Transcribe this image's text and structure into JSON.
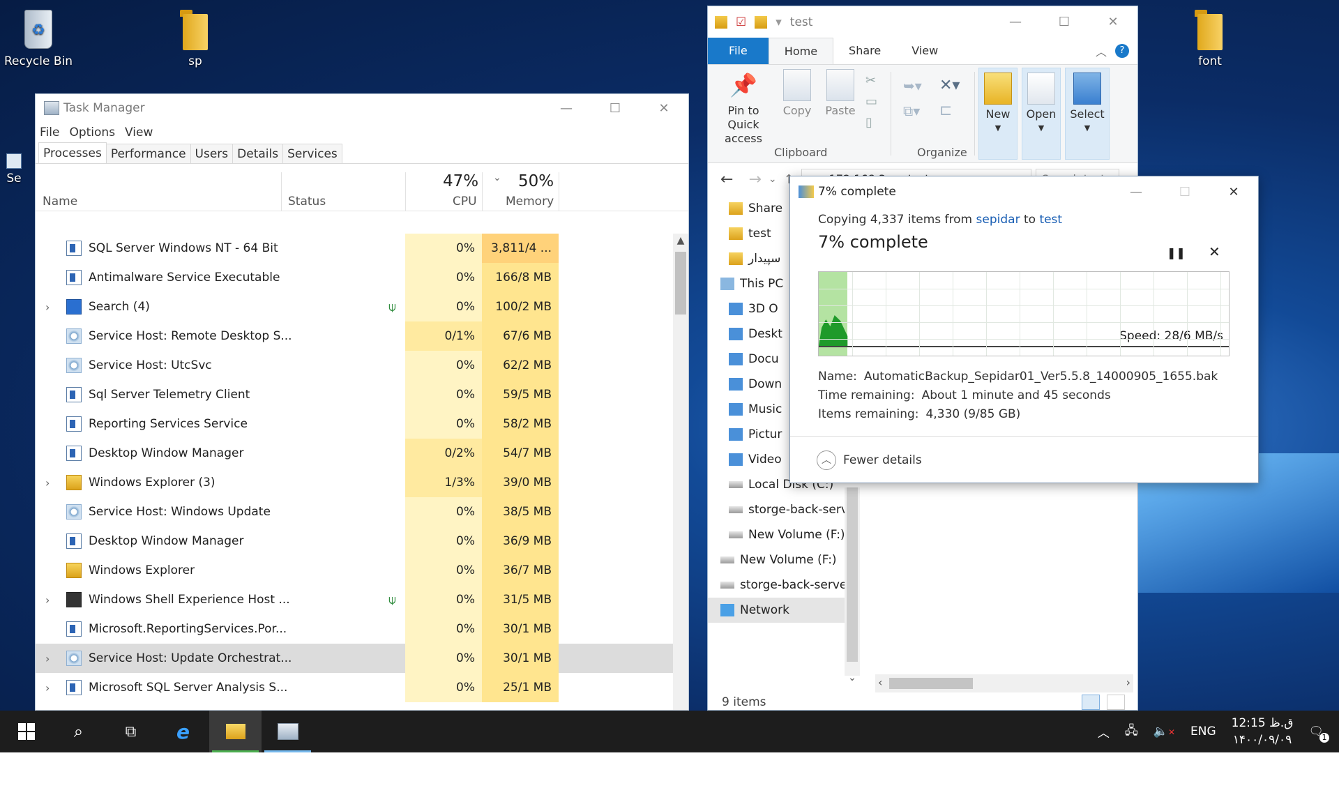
{
  "desktop": {
    "icons": [
      {
        "label": "Recycle Bin"
      },
      {
        "label": "sp"
      },
      {
        "label": "font"
      },
      {
        "label": "Se"
      }
    ]
  },
  "task_manager": {
    "title": "Task Manager",
    "menu": [
      "File",
      "Options",
      "View"
    ],
    "tabs": [
      "Processes",
      "Performance",
      "Users",
      "Details",
      "Services"
    ],
    "columns": {
      "name": "Name",
      "status": "Status",
      "cpu_pct": "47%",
      "cpu": "CPU",
      "mem_pct": "50%",
      "memory": "Memory"
    },
    "processes": [
      {
        "name": "SQL Server Windows NT - 64 Bit",
        "cpu": "0%",
        "mem": "3,811/4 ...",
        "icon": "app",
        "expand": false,
        "leaf": false
      },
      {
        "name": "Antimalware Service Executable",
        "cpu": "0%",
        "mem": "166/8 MB",
        "icon": "app",
        "expand": false,
        "leaf": false
      },
      {
        "name": "Search (4)",
        "cpu": "0%",
        "mem": "100/2 MB",
        "icon": "search",
        "expand": true,
        "leaf": true
      },
      {
        "name": "Service Host: Remote Desktop S...",
        "cpu": "0/1%",
        "mem": "67/6 MB",
        "icon": "svc",
        "expand": false,
        "leaf": false
      },
      {
        "name": "Service Host: UtcSvc",
        "cpu": "0%",
        "mem": "62/2 MB",
        "icon": "svc",
        "expand": false,
        "leaf": false
      },
      {
        "name": "Sql Server Telemetry Client",
        "cpu": "0%",
        "mem": "59/5 MB",
        "icon": "app",
        "expand": false,
        "leaf": false
      },
      {
        "name": "Reporting Services Service",
        "cpu": "0%",
        "mem": "58/2 MB",
        "icon": "app",
        "expand": false,
        "leaf": false
      },
      {
        "name": "Desktop Window Manager",
        "cpu": "0/2%",
        "mem": "54/7 MB",
        "icon": "app",
        "expand": false,
        "leaf": false
      },
      {
        "name": "Windows Explorer (3)",
        "cpu": "1/3%",
        "mem": "39/0 MB",
        "icon": "explorer",
        "expand": true,
        "leaf": false
      },
      {
        "name": "Service Host: Windows Update",
        "cpu": "0%",
        "mem": "38/5 MB",
        "icon": "svc",
        "expand": false,
        "leaf": false
      },
      {
        "name": "Desktop Window Manager",
        "cpu": "0%",
        "mem": "36/9 MB",
        "icon": "app",
        "expand": false,
        "leaf": false
      },
      {
        "name": "Windows Explorer",
        "cpu": "0%",
        "mem": "36/7 MB",
        "icon": "explorer",
        "expand": false,
        "leaf": false
      },
      {
        "name": "Windows Shell Experience Host ...",
        "cpu": "0%",
        "mem": "31/5 MB",
        "icon": "shell",
        "expand": true,
        "leaf": true
      },
      {
        "name": "Microsoft.ReportingServices.Por...",
        "cpu": "0%",
        "mem": "30/1 MB",
        "icon": "app",
        "expand": false,
        "leaf": false
      },
      {
        "name": "Service Host: Update Orchestrat...",
        "cpu": "0%",
        "mem": "30/1 MB",
        "icon": "svc",
        "expand": true,
        "leaf": false,
        "selected": true
      },
      {
        "name": "Microsoft SQL Server Analysis S...",
        "cpu": "0%",
        "mem": "25/1 MB",
        "icon": "app",
        "expand": true,
        "leaf": false
      }
    ],
    "colors": {
      "cpu_light": "#fff4c4",
      "cpu_mid": "#ffeaa0",
      "mem_hot": "#ffd27a",
      "mem_mid": "#ffe58f"
    }
  },
  "explorer": {
    "title": "test",
    "ribbon_tabs": [
      "File",
      "Home",
      "Share",
      "View"
    ],
    "buttons": {
      "pin": "Pin to Quick access",
      "copy": "Copy",
      "paste": "Paste",
      "new": "New",
      "open": "Open",
      "select": "Select"
    },
    "groups": {
      "clipboard": "Clipboard",
      "organize": "Organize"
    },
    "address": "« 172.168.3... › test ›",
    "search_placeholder": "Search test",
    "nav": [
      {
        "label": "Share",
        "icon": "folder"
      },
      {
        "label": "test",
        "icon": "folder"
      },
      {
        "label": "سپیدار",
        "icon": "folder"
      },
      {
        "label": "This PC",
        "icon": "pc"
      },
      {
        "label": "3D O",
        "icon": "sys"
      },
      {
        "label": "Deskt",
        "icon": "sys"
      },
      {
        "label": "Docu",
        "icon": "sys"
      },
      {
        "label": "Down",
        "icon": "sys"
      },
      {
        "label": "Music",
        "icon": "sys"
      },
      {
        "label": "Pictur",
        "icon": "sys"
      },
      {
        "label": "Video",
        "icon": "sys"
      },
      {
        "label": "Local Disk (C:)",
        "icon": "drv"
      },
      {
        "label": "storge-back-serv",
        "icon": "drv"
      },
      {
        "label": "New Volume (F:)",
        "icon": "drv"
      },
      {
        "label": "New Volume (F:)",
        "icon": "drv"
      },
      {
        "label": "storge-back-serve",
        "icon": "drv"
      },
      {
        "label": "Network",
        "icon": "net"
      }
    ],
    "status": "9 items"
  },
  "copy_dialog": {
    "title": "7% complete",
    "copying_prefix": "Copying 4,337 items from ",
    "from": "sepidar",
    "to_word": " to ",
    "to": "test",
    "progress_text": "7% complete",
    "progress": 0.07,
    "speed": "Speed: 28/6 MB/s",
    "name_label": "Name:",
    "name_value": "AutomaticBackup_Sepidar01_Ver5.5.8_14000905_1655.bak",
    "time_label": "Time remaining:",
    "time_value": "About 1 minute and 45 seconds",
    "items_label": "Items remaining:",
    "items_value": "4,330 (9/85 GB)",
    "fewer": "Fewer details",
    "colors": {
      "fill": "#b4e3a2",
      "curve": "#1f9a2a"
    }
  },
  "taskbar": {
    "lang": "ENG",
    "time": "12:15 ق.ظ",
    "date": "۱۴۰۰/۰۹/۰۹",
    "notifications": "1"
  }
}
